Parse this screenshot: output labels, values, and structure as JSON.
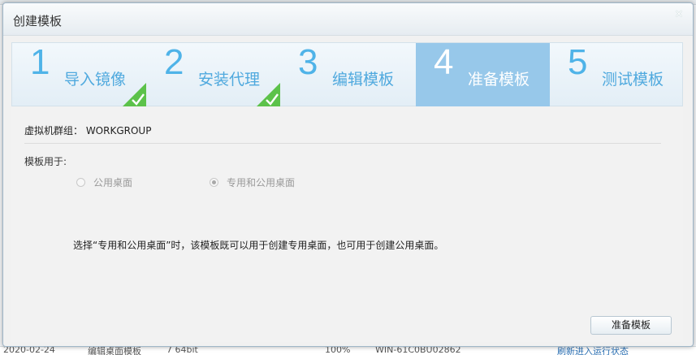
{
  "dialog": {
    "title": "创建模板",
    "close_glyph": "×"
  },
  "steps": [
    {
      "num": "1",
      "label": "导入镜像",
      "done": true,
      "active": false
    },
    {
      "num": "2",
      "label": "安装代理",
      "done": true,
      "active": false
    },
    {
      "num": "3",
      "label": "编辑模板",
      "done": false,
      "active": false
    },
    {
      "num": "4",
      "label": "准备模板",
      "done": false,
      "active": true
    },
    {
      "num": "5",
      "label": "测试模板",
      "done": false,
      "active": false
    }
  ],
  "content": {
    "vm_group": "虚拟机群组： WORKGROUP",
    "usage_label": "模板用于:",
    "options": [
      {
        "label": "公用桌面",
        "checked": false
      },
      {
        "label": "专用和公用桌面",
        "checked": true
      }
    ],
    "hint": "选择“专用和公用桌面”时，该模板既可以用于创建专用桌面，也可用于创建公用桌面。",
    "prepare_button": "准备模板"
  },
  "background": {
    "bottom_row": [
      "2020-02-24",
      "编辑桌面模板",
      "7 64bit",
      "100%",
      "WIN-61C0BU02862",
      "刷新进入运行状态"
    ]
  },
  "colors": {
    "step_text": "#4fa9de",
    "step_active_bg": "#97c8ea",
    "done_badge": "#5cc24a"
  },
  "icons": {
    "close": "close-icon",
    "done": "checkmark-icon"
  }
}
